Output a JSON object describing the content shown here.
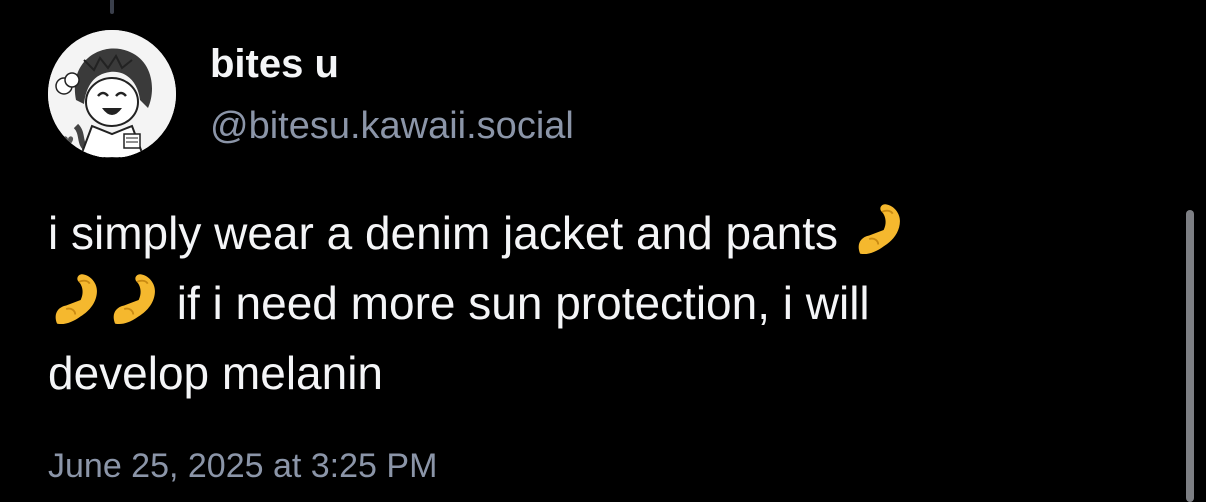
{
  "author": {
    "display_name": "bites u",
    "handle": "@bitesu.kawaii.social",
    "avatar_icon": "avatar-manga-girl-icon"
  },
  "post": {
    "text_line1": "i simply wear a denim jacket and pants",
    "emoji": "flexed-biceps",
    "text_line2": "if i need more sun protection, i will",
    "text_line3": "develop melanin"
  },
  "timestamp": "June 25, 2025 at 3:25 PM",
  "colors": {
    "background": "#000000",
    "primary_text": "#f4f5f7",
    "secondary_text": "#8b95a8",
    "emoji": "#f5b82e"
  }
}
